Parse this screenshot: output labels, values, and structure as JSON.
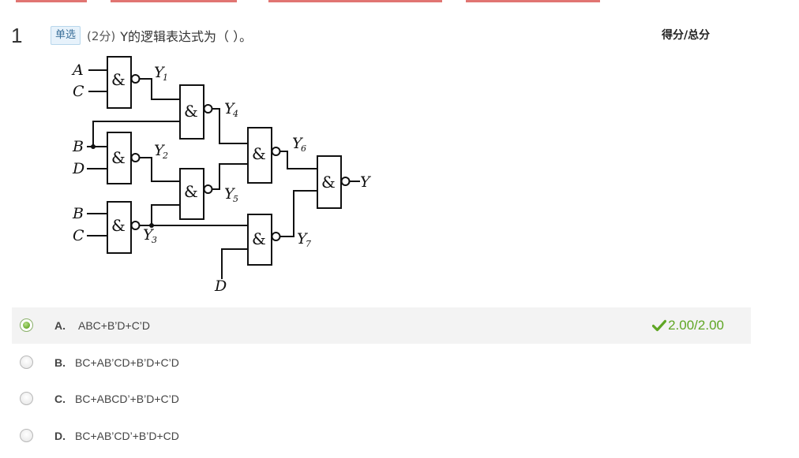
{
  "question": {
    "number": "1",
    "type_label": "单选",
    "points": "(2分)",
    "text": "Y的逻辑表达式为（    ）。",
    "score_header": "得分/总分"
  },
  "diagram": {
    "labels": {
      "A": "A",
      "C": "C",
      "B": "B",
      "D": "D",
      "Y": "Y",
      "Y1": "1",
      "Y2": "2",
      "Y3": "3",
      "Y4": "4",
      "Y5": "5",
      "Y6": "6",
      "Y7": "7",
      "gate": "&"
    }
  },
  "options": [
    {
      "letter": "A.",
      "text": "ABC+B’D+C’D",
      "selected": true,
      "score": "2.00/2.00"
    },
    {
      "letter": "B.",
      "text": "BC+AB’CD+B’D+C’D",
      "selected": false
    },
    {
      "letter": "C.",
      "text": "BC+ABCD’+B’D+C’D",
      "selected": false
    },
    {
      "letter": "D.",
      "text": "BC+AB’CD’+B’D+CD",
      "selected": false
    }
  ],
  "colors": {
    "correct": "#5fa624",
    "badge_bg": "#e7f2fb",
    "selected_row_bg": "#f3f3f3"
  },
  "icons": {
    "correct": "check-icon",
    "radio_checked": "radio-checked-icon",
    "radio_unchecked": "radio-unchecked-icon"
  }
}
